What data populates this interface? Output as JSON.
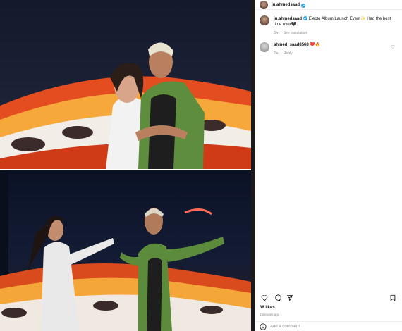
{
  "post": {
    "username": "ju.ahmedsaad",
    "verified": true
  },
  "caption": {
    "username": "ju.ahmedsaad",
    "text": "Electo Album Launch Event✨ Had the best time ever🖤",
    "age": "3w",
    "see_translation": "See translation"
  },
  "comments": [
    {
      "username": "ahmed_saad8568",
      "text": "❤️🔥",
      "age": "2w",
      "reply_label": "Reply"
    }
  ],
  "engagement": {
    "likes": "38 likes",
    "time": "3 minutes ago"
  },
  "add_comment": {
    "placeholder": "Add a comment…"
  },
  "icons": [
    "heart-icon",
    "comment-icon",
    "share-icon",
    "bookmark-icon",
    "smile-icon"
  ]
}
